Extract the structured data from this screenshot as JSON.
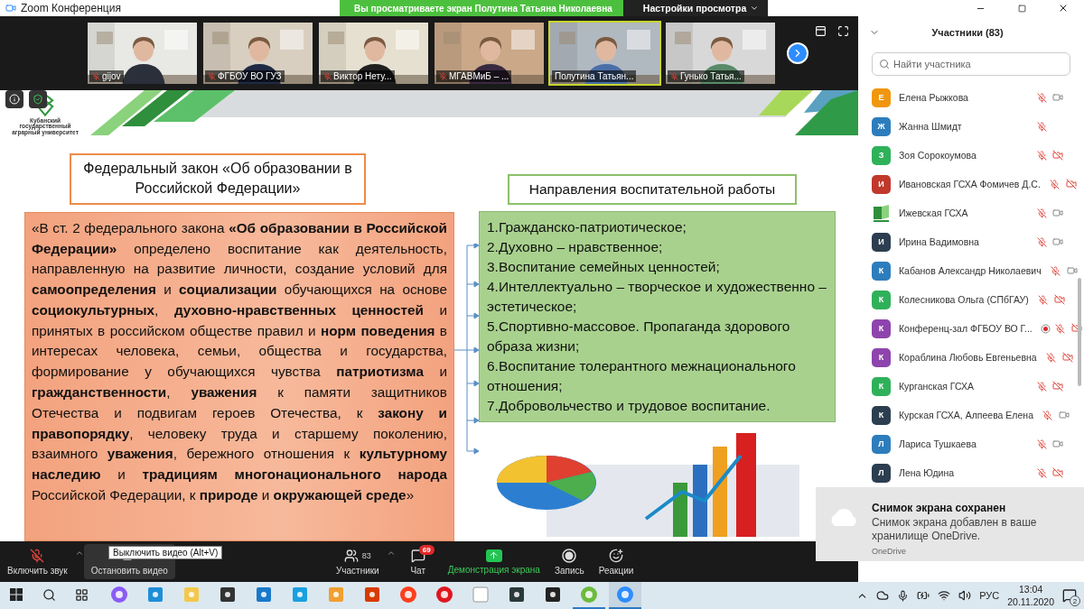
{
  "window": {
    "title": "Zoom Конференция"
  },
  "share_banner": {
    "text": "Вы просматриваете экран Полутина Татьяна Николаевна",
    "button": "Настройки просмотра"
  },
  "video_tiles": [
    {
      "name": "gijov",
      "muted": true,
      "speaking": false
    },
    {
      "name": "ФГБОУ ВО ГУЗ",
      "muted": true,
      "speaking": false
    },
    {
      "name": "Виктор Нету...",
      "muted": true,
      "speaking": false
    },
    {
      "name": "МГАВМиБ – ...",
      "muted": true,
      "speaking": false
    },
    {
      "name": "Полутина Татьян...",
      "muted": false,
      "speaking": true
    },
    {
      "name": "Гунько Татья...",
      "muted": true,
      "speaking": false
    }
  ],
  "slide": {
    "logo_text": "Кубанский государственный аграрный университет",
    "left_title": "Федеральный закон «Об образовании в Российской Федерации»",
    "law_text": "«В ст. 2 федерального закона **«Об образовании в Российской Федерации»** определено воспитание как деятельность, направленную на развитие личности, создание условий для **самоопределения** и **социализации** обучающихся на основе **социокультурных**, **духовно-нравственных ценностей** и принятых в российском обществе правил и **норм поведения** в интересах человека, семьи, общества и государства, формирование у обучающихся чувства **патриотизма** и **гражданственности**, **уважения** к памяти защитников Отечества и подвигам героев Отечества, к **закону и правопорядку**, человеку труда и старшему поколению, взаимного **уважения**, бережного отношения к **культурному наследию** и **традициям многонационального народа** Российской Федерации, к **природе** и **окружающей среде**»",
    "right_title": "Направления воспитательной работы",
    "directions": [
      "1.Гражданско-патриотическое;",
      "2.Духовно – нравственное;",
      "3.Воспитание семейных ценностей;",
      "4.Интеллектуально – творческое и художественно – эстетическое;",
      "5.Спортивно-массовое. Пропаганда здорового образа жизни;",
      "6.Воспитание толерантного межнационального отношения;",
      "7.Добровольчество и трудовое воспитание."
    ]
  },
  "toolbar": {
    "items": [
      {
        "kind": "audio",
        "label": "Включить звук",
        "on": false
      },
      {
        "kind": "video",
        "label": "Остановить видео",
        "on": true
      },
      {
        "kind": "participants",
        "label": "Участники",
        "count": "83"
      },
      {
        "kind": "chat",
        "label": "Чат",
        "count": "69"
      },
      {
        "kind": "share",
        "label": "Демонстрация экрана"
      },
      {
        "kind": "record",
        "label": "Запись"
      },
      {
        "kind": "reactions",
        "label": "Реакции"
      }
    ],
    "tooltip": "Выключить видео (Alt+V)"
  },
  "participants_panel": {
    "title": "Участники (83)",
    "search": {
      "placeholder": "Найти участника"
    },
    "participants": [
      {
        "kind": "initial",
        "initial": "Е",
        "color": "#f0960f",
        "name": "Елена Рыжкова",
        "muted": true,
        "video_shown": true,
        "video_on": true,
        "recording": false
      },
      {
        "kind": "initial",
        "initial": "Ж",
        "color": "#2d7dbd",
        "name": "Жанна Шмидт",
        "muted": true,
        "video_shown": false,
        "recording": false
      },
      {
        "kind": "initial",
        "initial": "З",
        "color": "#2fb15a",
        "name": "Зоя Сорокоумова",
        "muted": true,
        "video_shown": true,
        "video_on": false,
        "recording": false
      },
      {
        "kind": "initial",
        "initial": "И",
        "color": "#c0392b",
        "name": "Ивановская ГСХА Фомичев Д.С.",
        "muted": true,
        "video_shown": true,
        "video_on": false,
        "recording": false
      },
      {
        "kind": "logo",
        "name": "Ижевская ГСХА",
        "muted": true,
        "video_shown": true,
        "video_on": true,
        "recording": false
      },
      {
        "kind": "initial",
        "initial": "И",
        "color": "#2c3e50",
        "name": "Ирина Вадимовна",
        "muted": true,
        "video_shown": true,
        "video_on": true,
        "recording": false
      },
      {
        "kind": "initial",
        "initial": "К",
        "color": "#2d7dbd",
        "name": "Кабанов Александр Николаевич",
        "muted": true,
        "video_shown": true,
        "video_on": true,
        "recording": false
      },
      {
        "kind": "initial",
        "initial": "К",
        "color": "#2fb15a",
        "name": "Колесникова Ольга (СПбГАУ)",
        "muted": true,
        "video_shown": true,
        "video_on": false,
        "recording": false
      },
      {
        "kind": "initial",
        "initial": "К",
        "color": "#8e44ad",
        "name": "Конференц-зал ФГБОУ ВО Г...",
        "muted": true,
        "video_shown": true,
        "video_on": false,
        "recording": true
      },
      {
        "kind": "initial",
        "initial": "К",
        "color": "#8e44ad",
        "name": "Кораблина Любовь Евгеньевна",
        "muted": true,
        "video_shown": true,
        "video_on": false,
        "recording": false
      },
      {
        "kind": "initial",
        "initial": "К",
        "color": "#2fb15a",
        "name": "Курганская ГСХА",
        "muted": true,
        "video_shown": true,
        "video_on": false,
        "recording": false
      },
      {
        "kind": "initial",
        "initial": "К",
        "color": "#2c3e50",
        "name": "Курская ГСХА, Алпеева Елена",
        "muted": true,
        "video_shown": true,
        "video_on": true,
        "recording": false
      },
      {
        "kind": "initial",
        "initial": "Л",
        "color": "#2d7dbd",
        "name": "Лариса Тушкаева",
        "muted": true,
        "video_shown": true,
        "video_on": true,
        "recording": false
      },
      {
        "kind": "initial",
        "initial": "Л",
        "color": "#2c3e50",
        "name": "Лена Юдина",
        "muted": true,
        "video_shown": true,
        "video_on": false,
        "recording": false
      }
    ]
  },
  "toast": {
    "title": "Снимок экрана сохранен",
    "message": "Снимок экрана добавлен в ваше хранилище OneDrive.",
    "source": "OneDrive"
  },
  "taskbar": {
    "apps": [
      {
        "kind": "alice",
        "running": false
      },
      {
        "kind": "edge",
        "running": false
      },
      {
        "kind": "folder",
        "running": false
      },
      {
        "kind": "store",
        "running": false
      },
      {
        "kind": "mail",
        "running": false
      },
      {
        "kind": "lapp",
        "running": false
      },
      {
        "kind": "paint",
        "running": false
      },
      {
        "kind": "office",
        "running": false
      },
      {
        "kind": "yandex",
        "running": false
      },
      {
        "kind": "opera",
        "running": false
      },
      {
        "kind": "file",
        "running": false
      },
      {
        "kind": "blitz",
        "running": false
      },
      {
        "kind": "tank",
        "running": false
      },
      {
        "kind": "torrent",
        "running": true
      },
      {
        "kind": "zoom",
        "running": true
      }
    ],
    "language": "РУС",
    "time": "13:04",
    "date": "20.11.2020",
    "notifications": "2"
  }
}
